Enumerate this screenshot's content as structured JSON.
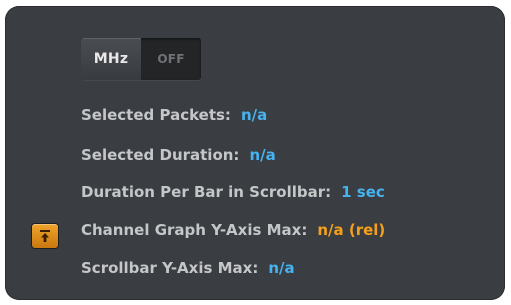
{
  "toggle": {
    "on_label": "MHz",
    "off_label": "OFF"
  },
  "stats": [
    {
      "label": "Selected Packets:",
      "value": "n/a",
      "value_color": "#46b3f0"
    },
    {
      "label": "Selected Duration:",
      "value": "n/a",
      "value_color": "#46b3f0"
    },
    {
      "label": "Duration Per Bar in Scrollbar:",
      "value": "1 sec",
      "value_color": "#46b3f0"
    },
    {
      "label": "Channel Graph Y-Axis Max:",
      "value": "n/a (rel)",
      "value_color": "#f5a01c"
    },
    {
      "label": "Scrollbar Y-Axis Max:",
      "value": "n/a",
      "value_color": "#46b3f0"
    }
  ],
  "pin_button": {
    "icon": "pin-top-icon",
    "accent": "#f0a52a"
  }
}
